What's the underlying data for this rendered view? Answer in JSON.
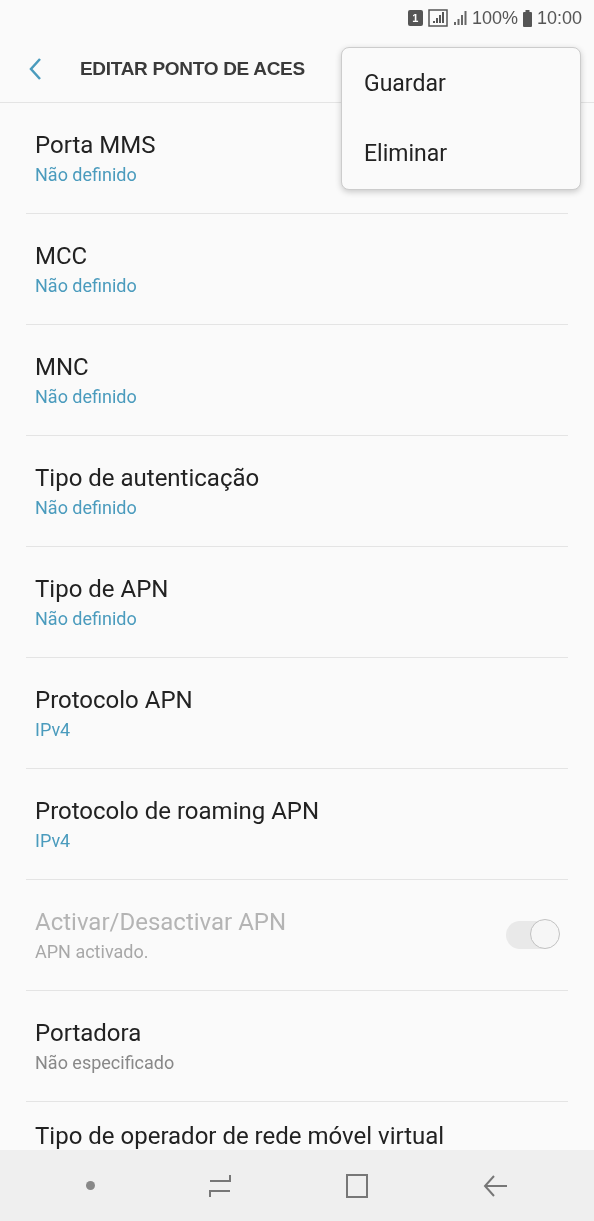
{
  "status_bar": {
    "sim_label": "1",
    "battery": "100%",
    "time": "10:00"
  },
  "header": {
    "title": "EDITAR PONTO DE ACES"
  },
  "menu": {
    "items": [
      {
        "label": "Guardar"
      },
      {
        "label": "Eliminar"
      }
    ]
  },
  "settings": [
    {
      "kind": "text",
      "title": "Porta MMS",
      "value": "Não definido",
      "accent": true
    },
    {
      "kind": "text",
      "title": "MCC",
      "value": "Não definido",
      "accent": true
    },
    {
      "kind": "text",
      "title": "MNC",
      "value": "Não definido",
      "accent": true
    },
    {
      "kind": "text",
      "title": "Tipo de autenticação",
      "value": "Não definido",
      "accent": true
    },
    {
      "kind": "text",
      "title": "Tipo de APN",
      "value": "Não definido",
      "accent": true
    },
    {
      "kind": "text",
      "title": "Protocolo APN",
      "value": "IPv4",
      "accent": true
    },
    {
      "kind": "text",
      "title": "Protocolo de roaming APN",
      "value": "IPv4",
      "accent": true
    },
    {
      "kind": "toggle",
      "title": "Activar/Desactivar APN",
      "value": "APN activado.",
      "disabled": true,
      "on": true
    },
    {
      "kind": "text",
      "title": "Portadora",
      "value": "Não especificado",
      "accent": false
    },
    {
      "kind": "partial",
      "title": "Tipo de operador de rede móvel virtual"
    }
  ]
}
